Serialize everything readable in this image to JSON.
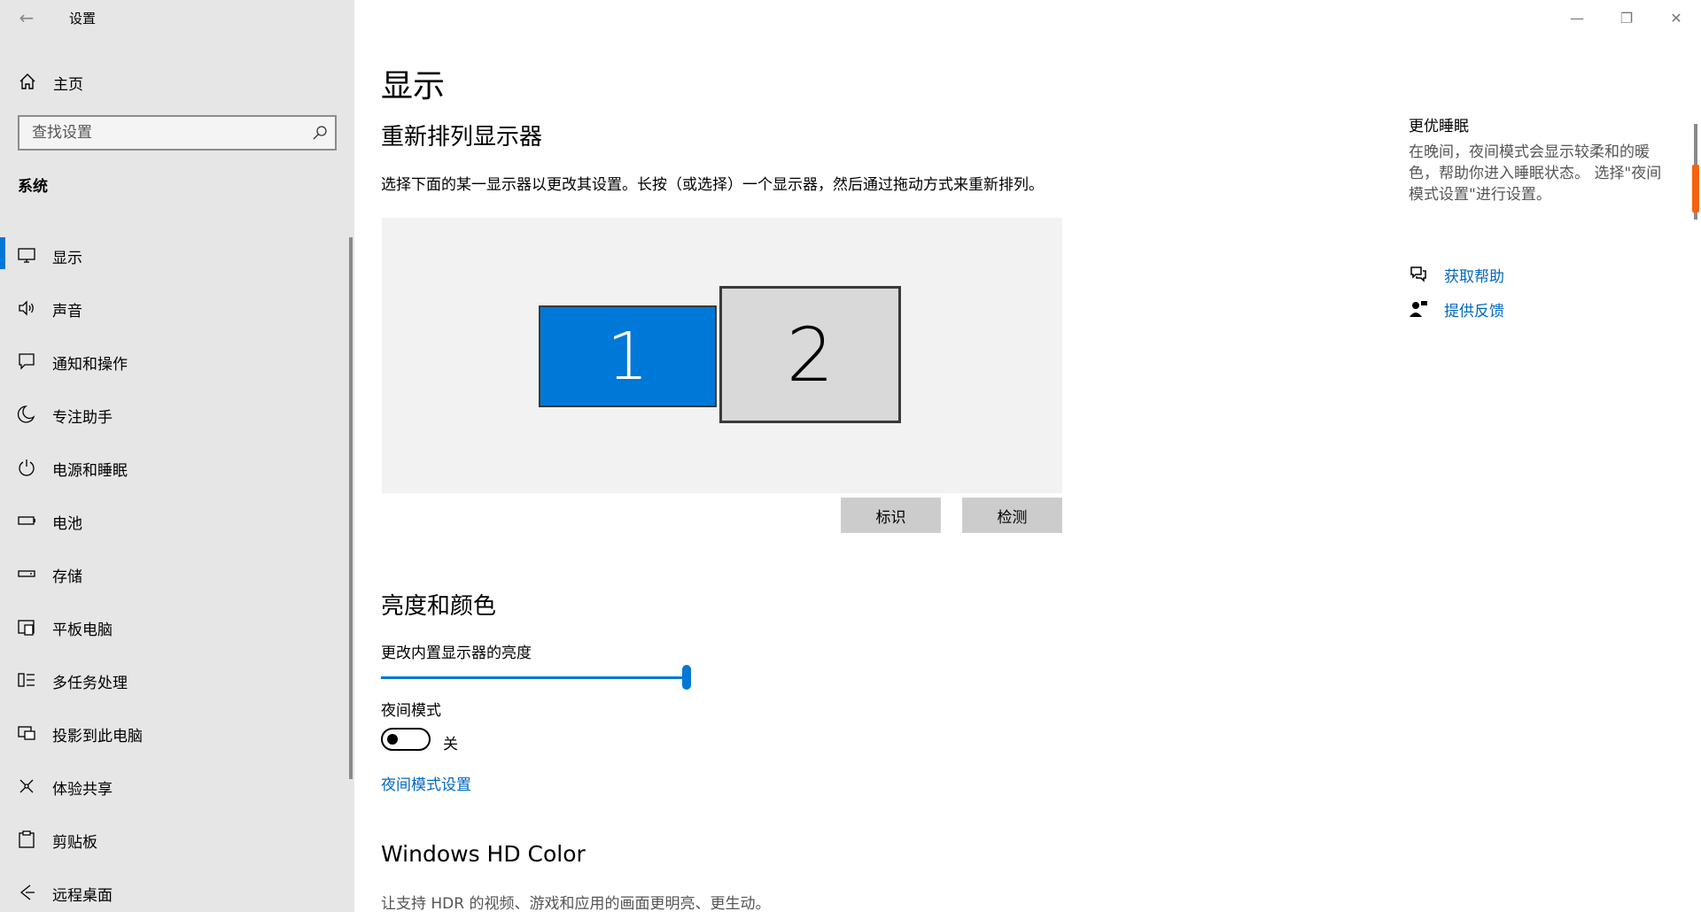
{
  "window": {
    "app_title": "设置",
    "back_glyph": "←",
    "minimize_glyph": "—",
    "restore_glyph": "❐",
    "close_glyph": "✕"
  },
  "sidebar": {
    "home_label": "主页",
    "search_placeholder": "查找设置",
    "section_title": "系统",
    "items": [
      {
        "label": "显示",
        "icon": "monitor-icon"
      },
      {
        "label": "声音",
        "icon": "speaker-icon"
      },
      {
        "label": "通知和操作",
        "icon": "notification-icon"
      },
      {
        "label": "专注助手",
        "icon": "moon-icon"
      },
      {
        "label": "电源和睡眠",
        "icon": "power-icon"
      },
      {
        "label": "电池",
        "icon": "battery-icon"
      },
      {
        "label": "存储",
        "icon": "storage-icon"
      },
      {
        "label": "平板电脑",
        "icon": "tablet-icon"
      },
      {
        "label": "多任务处理",
        "icon": "multitasking-icon"
      },
      {
        "label": "投影到此电脑",
        "icon": "projecting-icon"
      },
      {
        "label": "体验共享",
        "icon": "shared-experiences-icon"
      },
      {
        "label": "剪贴板",
        "icon": "clipboard-icon"
      },
      {
        "label": "远程桌面",
        "icon": "remote-desktop-icon"
      }
    ],
    "active_index": 0
  },
  "main": {
    "page_title": "显示",
    "rearrange": {
      "heading": "重新排列显示器",
      "description": "选择下面的某一显示器以更改其设置。长按（或选择）一个显示器，然后通过拖动方式来重新排列。",
      "monitor1_label": "1",
      "monitor2_label": "2",
      "identify_button": "标识",
      "detect_button": "检测"
    },
    "brightness": {
      "heading": "亮度和颜色",
      "slider_label": "更改内置显示器的亮度",
      "slider_value_fraction": 1.0,
      "night_light_label": "夜间模式",
      "night_light_state": "关",
      "night_light_settings_link": "夜间模式设置"
    },
    "hdr": {
      "heading": "Windows HD Color",
      "description": "让支持 HDR 的视频、游戏和应用的画面更明亮、更生动。"
    }
  },
  "right_column": {
    "title": "更优睡眠",
    "description": "在晚间，夜间模式会显示较柔和的暖色，帮助你进入睡眠状态。 选择\"夜间模式设置\"进行设置。",
    "get_help": "获取帮助",
    "give_feedback": "提供反馈"
  },
  "colors": {
    "accent": "#0078d7",
    "link": "#0067c0",
    "sidebar_bg": "#e6e6e6",
    "scroll_accent": "#f7630c"
  }
}
